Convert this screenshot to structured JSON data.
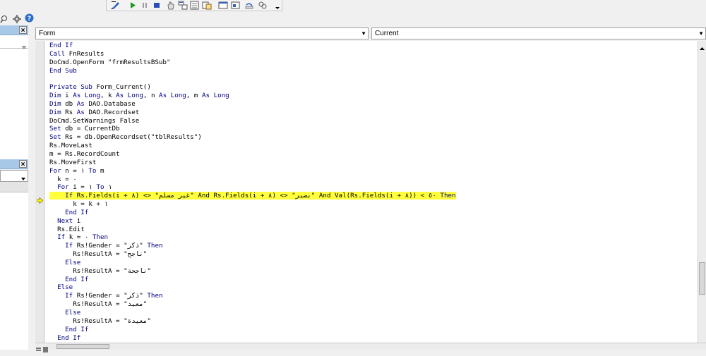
{
  "proc_combo": {
    "object": "Form",
    "procedure": "Current"
  },
  "icons": {
    "toolbar": [
      "design-mode-icon",
      "run-icon",
      "break-icon",
      "reset-icon",
      "hand-icon",
      "project-explorer-icon",
      "properties-icon",
      "object-browser-icon",
      "toolbox-icon",
      "form-icon",
      "undo-icon",
      "help-icon"
    ],
    "left": [
      "search-icon",
      "settings-icon",
      "help-icon"
    ]
  },
  "colors": {
    "highlight": "#ffff3c",
    "keyword": "#000080",
    "exec_arrow": "#ffff00"
  },
  "code": {
    "lines": [
      "End If",
      "Call FnResults",
      "DoCmd.OpenForm \"frmResultsBSub\"",
      "End Sub",
      "",
      "Private Sub Form_Current()",
      "Dim i As Long, k As Long, n As Long, m As Long",
      "Dim db As DAO.Database",
      "Dim Rs As DAO.Recordset",
      "DoCmd.SetWarnings False",
      "Set db = CurrentDb",
      "Set Rs = db.OpenRecordset(\"tblResults\")",
      "Rs.MoveLast",
      "m = Rs.RecordCount",
      "Rs.MoveFirst",
      "For n = ١ To m",
      "  k = ٠",
      "  For i = ١ To ١",
      "    If Rs.Fields(i + ٨) <> \"غير مسلم\" And Rs.Fields(i + ٨) <> \"بصير\" And Val(Rs.Fields(i + ٨)) < ٥٠ Then",
      "      k = k + ١",
      "    End If",
      "  Next i",
      "  Rs.Edit",
      "  If k = ٠ Then",
      "    If Rs!Gender = \"ذكر\" Then",
      "      Rs!ResultA = \"ناجح\"",
      "    Else",
      "      Rs!ResultA = \"ناجحة\"",
      "    End If",
      "  Else",
      "    If Rs!Gender = \"ذكر\" Then",
      "      Rs!ResultA = \"معيد\"",
      "    Else",
      "      Rs!ResultA = \"معيدة\"",
      "    End If",
      "  End If"
    ],
    "highlighted_line": 18
  }
}
